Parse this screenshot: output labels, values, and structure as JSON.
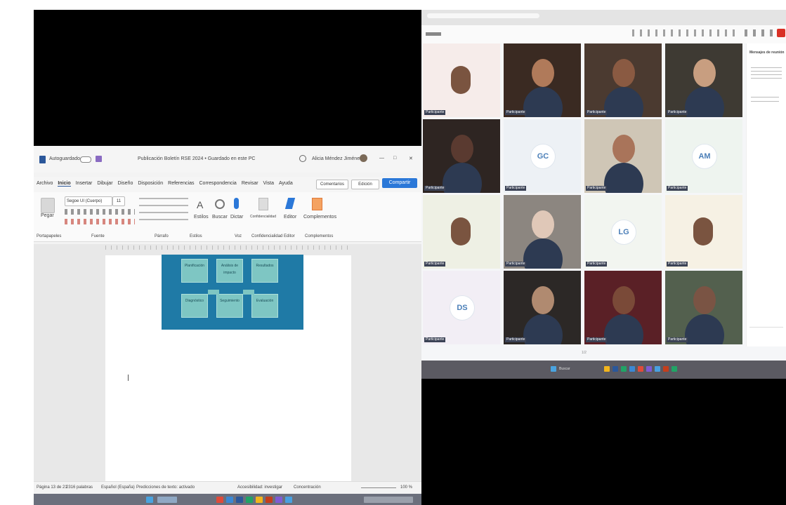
{
  "word": {
    "autosave_label": "Autoguardado",
    "doc_title": "Publicación Boletín RSE 2024 • Guardado en este PC",
    "user_name": "Alicia Méndez Jiménez",
    "tabs": [
      "Archivo",
      "Inicio",
      "Insertar",
      "Dibujar",
      "Diseño",
      "Disposición",
      "Referencias",
      "Correspondencia",
      "Revisar",
      "Vista",
      "Ayuda"
    ],
    "comments_label": "Comentarios",
    "edit_label": "Edición",
    "share_label": "Compartir",
    "ribbon_groups": [
      "Portapapeles",
      "Fuente",
      "Párrafo",
      "Estilos",
      "Voz",
      "Confidencialidad",
      "Editor",
      "Complementos"
    ],
    "font_name": "Segoe UI (Cuerpo)",
    "font_size": "11",
    "ribbon_buttons": [
      "Estilos",
      "Buscar",
      "Dictar",
      "Confidencialidad",
      "Editor",
      "Complementos"
    ],
    "paste_label": "Pegar",
    "diagram_boxes": [
      "Planificación",
      "Análisis de impacto",
      "Resultados",
      "Diagnóstico",
      "Seguimiento",
      "Evaluación"
    ],
    "status": {
      "page": "Página 13 de 21",
      "words": "2316 palabras",
      "language": "Español (España)",
      "predictions": "Predicciones de texto: activado",
      "accessibility": "Accesibilidad: investigar",
      "focus": "Concentración",
      "zoom": "100 %"
    }
  },
  "meet": {
    "participants": [
      {
        "name": "Participante",
        "type": "avatar",
        "bg": "#f6ecea"
      },
      {
        "name": "Participante",
        "type": "video",
        "bg": "#3a2a22",
        "skin": "#b07a5a"
      },
      {
        "name": "Participante",
        "type": "video",
        "bg": "#4b3a30",
        "skin": "#8a5a42"
      },
      {
        "name": "Participante",
        "type": "video",
        "bg": "#3e3a33",
        "skin": "#c89e80"
      },
      {
        "name": "Participante",
        "type": "video",
        "bg": "#2e2522",
        "skin": "#5a3a30"
      },
      {
        "name": "Participante",
        "type": "initials",
        "initials": "GC",
        "bg": "#edf1f5"
      },
      {
        "name": "Participante",
        "type": "video",
        "bg": "#cfc6b6",
        "skin": "#a9745a"
      },
      {
        "name": "Participante",
        "type": "initials",
        "initials": "AM",
        "bg": "#eef4ef"
      },
      {
        "name": "Participante",
        "type": "avatar",
        "bg": "#eef0e4"
      },
      {
        "name": "Participante",
        "type": "video",
        "bg": "#8c8680",
        "skin": "#e0c8b8"
      },
      {
        "name": "Participante",
        "type": "initials",
        "initials": "LG",
        "bg": "#f2f5f0"
      },
      {
        "name": "Participante",
        "type": "avatar",
        "bg": "#f6f1e4"
      },
      {
        "name": "Participante",
        "type": "initials",
        "initials": "DS",
        "bg": "#f2eef5"
      },
      {
        "name": "Participante",
        "type": "video",
        "bg": "#2c2826",
        "skin": "#b08a70"
      },
      {
        "name": "Participante",
        "type": "video",
        "bg": "#5a2026",
        "skin": "#7a4a38"
      },
      {
        "name": "Participante",
        "type": "video",
        "bg": "#53604e",
        "skin": "#7a5444"
      }
    ],
    "side_title": "Mensajes de reunión",
    "page_indicator": "1/2",
    "window_search": "Buscar"
  }
}
